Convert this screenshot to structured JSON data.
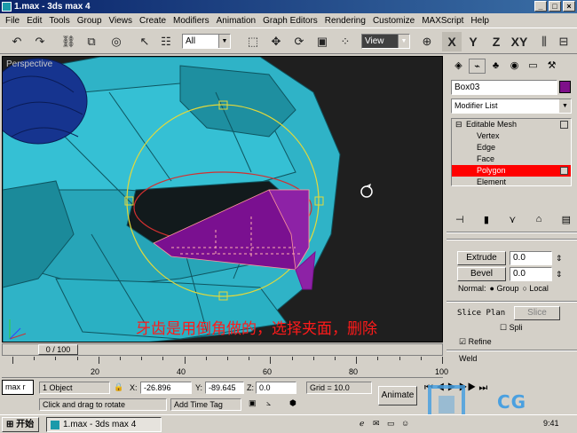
{
  "window": {
    "title": "1.max - 3ds max 4"
  },
  "menu": [
    "File",
    "Edit",
    "Tools",
    "Group",
    "Views",
    "Create",
    "Modifiers",
    "Animation",
    "Graph Editors",
    "Rendering",
    "Customize",
    "MAXScript",
    "Help"
  ],
  "toolbar": {
    "selection_filter": "All",
    "coord_system": "View",
    "axis_labels": [
      "X",
      "Y",
      "Z",
      "XY"
    ]
  },
  "viewport": {
    "label": "Perspective",
    "overlay_caption": "牙齿是用倒角做的，选择夹面，删除"
  },
  "command_panel": {
    "object_name": "Box03",
    "object_color": "#7e0f8a",
    "modifier_list_label": "Modifier List",
    "stack": {
      "root": "Editable Mesh",
      "items": [
        "Vertex",
        "Edge",
        "Face",
        "Polygon",
        "Element"
      ],
      "selected": "Polygon"
    },
    "extrude": {
      "label": "Extrude",
      "value": "0.0"
    },
    "bevel": {
      "label": "Bevel",
      "value": "0.0"
    },
    "normal": {
      "label": "Normal:",
      "option_group": "Group",
      "option_local": "Local"
    },
    "slice_plane": {
      "label": "Slice Plan",
      "slice_label": "Slice",
      "split_label": "Spli"
    },
    "refine_label": "Refine",
    "weld_label": "Weld"
  },
  "timeline": {
    "frame_display": "0 / 100",
    "ruler_numbers": [
      "20",
      "40",
      "60",
      "80",
      "100"
    ]
  },
  "status": {
    "maxscript_label": "max r",
    "selection_info": "1 Object",
    "x_label": "X:",
    "x_value": "-26.896",
    "y_label": "Y:",
    "y_value": "-89.645",
    "z_label": "Z:",
    "z_value": "0.0",
    "grid": "Grid = 10.0",
    "prompt": "Click and drag to rotate",
    "add_time_tag": "Add Time Tag",
    "animate": "Animate"
  },
  "taskbar": {
    "start_label": "开始",
    "task_item": "1.max - 3ds max 4",
    "clock": "9:41"
  },
  "watermark": {
    "text": "CG"
  }
}
